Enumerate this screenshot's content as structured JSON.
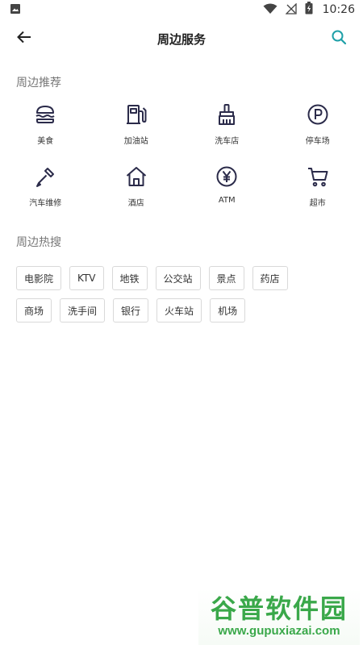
{
  "status_bar": {
    "time": "10:26",
    "icons": [
      "image-icon",
      "wifi-icon",
      "no-signal-icon",
      "battery-charging-icon"
    ]
  },
  "app_bar": {
    "title": "周边服务",
    "back_icon": "arrow-left-icon",
    "search_icon": "search-icon",
    "accent": "#1fa0a8"
  },
  "recommend": {
    "title": "周边推荐",
    "items": [
      {
        "label": "美食",
        "icon": "burger-icon"
      },
      {
        "label": "加油站",
        "icon": "fuel-pump-icon"
      },
      {
        "label": "洗车店",
        "icon": "brush-icon"
      },
      {
        "label": "停车场",
        "icon": "parking-icon"
      },
      {
        "label": "汽车维修",
        "icon": "screwdriver-icon"
      },
      {
        "label": "酒店",
        "icon": "house-icon"
      },
      {
        "label": "ATM",
        "icon": "yen-icon"
      },
      {
        "label": "超市",
        "icon": "cart-icon"
      }
    ]
  },
  "hot": {
    "title": "周边热搜",
    "tags": [
      "电影院",
      "KTV",
      "地铁",
      "公交站",
      "景点",
      "药店",
      "商场",
      "洗手间",
      "银行",
      "火车站",
      "机场"
    ]
  },
  "watermark": {
    "top": "谷普软件园",
    "bottom": "www.gupuxiazai.com"
  },
  "colors": {
    "icon_stroke": "#2b2b4a",
    "tag_border": "#d9d9d9"
  }
}
